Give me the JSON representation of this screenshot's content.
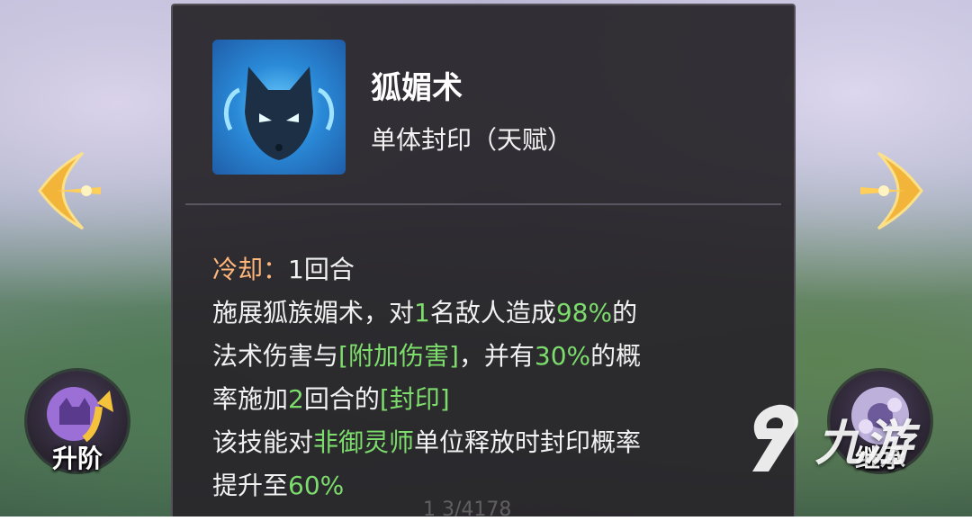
{
  "skill": {
    "icon": "fox-mask-icon",
    "name": "狐媚术",
    "type": "单体封印（天赋）"
  },
  "cooldown": {
    "label": "冷却：",
    "value": "1回合"
  },
  "description": {
    "l1_a": "施展狐族媚术，对",
    "l1_b": "1",
    "l1_c": "名敌人造成",
    "l1_d": "98%",
    "l1_e": "的",
    "l2_a": "法术伤害与",
    "l2_b": "[附加伤害]",
    "l2_c": "，并有",
    "l2_d": "30%",
    "l2_e": "的概",
    "l3_a": "率施加",
    "l3_b": "2",
    "l3_c": "回合的",
    "l3_d": "[封印]",
    "l4_a": "该技能对",
    "l4_b": "非御灵师",
    "l4_c": "单位释放时封印概率",
    "l5_a": "提升至",
    "l5_b": "60%"
  },
  "buttons": {
    "upgrade_label": "升阶",
    "inherit_label": "继承"
  },
  "watermark": {
    "text": "九游"
  },
  "footer_faded": "1 3/4178",
  "colors": {
    "highlight_green": "#7cdd6c",
    "cooldown_orange": "#ffb67a",
    "panel_bg": "#28252a",
    "arrow_gold": "#f2b53a"
  }
}
